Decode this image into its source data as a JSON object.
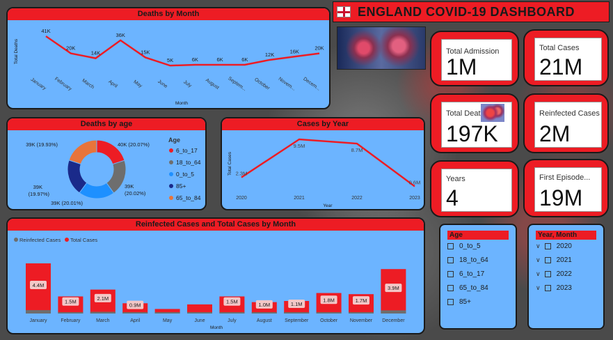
{
  "header": {
    "title": "ENGLAND COVID-19 DASHBOARD",
    "flag_icon": "uk-flag-icon"
  },
  "colors": {
    "accent": "#ed1c24",
    "panel": "#6cb4ff",
    "line": "#ed1c24",
    "gray_series": "#6e6e6e"
  },
  "deaths_by_month": {
    "title": "Deaths by Month",
    "ylabel": "Total Deaths",
    "xlabel": "Month",
    "months": [
      "January",
      "February",
      "March",
      "April",
      "May",
      "June",
      "July",
      "August",
      "Septem...",
      "October",
      "Novem...",
      "Decem..."
    ],
    "values": [
      41,
      20,
      14,
      36,
      15,
      5,
      6,
      6,
      6,
      12,
      16,
      20
    ],
    "labels": [
      "41K",
      "20K",
      "14K",
      "36K",
      "15K",
      "5K",
      "6K",
      "6K",
      "6K",
      "12K",
      "16K",
      "20K"
    ]
  },
  "deaths_by_age": {
    "title": "Deaths by age",
    "legend_title": "Age",
    "segments": [
      {
        "name": "6_to_17",
        "value": 20.07,
        "label": "40K (20.07%)",
        "color": "#ed1c24"
      },
      {
        "name": "18_to_64",
        "value": 20.02,
        "label": "39K (20.02%)",
        "color": "#6e6e6e"
      },
      {
        "name": "0_to_5",
        "value": 20.01,
        "label": "39K (20.01%)",
        "color": "#1e90ff"
      },
      {
        "name": "85+",
        "value": 19.97,
        "label": "39K (19.97%)",
        "color": "#1a2a8a"
      },
      {
        "name": "65_to_84",
        "value": 19.93,
        "label": "39K (19.93%)",
        "color": "#e8743a"
      }
    ]
  },
  "cases_by_year": {
    "title": "Cases by Year",
    "ylabel": "Total Cases",
    "xlabel": "Year",
    "years": [
      "2020",
      "2021",
      "2022",
      "2023"
    ],
    "values": [
      2.3,
      9.5,
      8.7,
      0.6
    ],
    "labels": [
      "2.3M",
      "9.5M",
      "8.7M",
      "0.6M"
    ]
  },
  "reinfected": {
    "title": "Reinfected Cases and Total Cases by Month",
    "legend": [
      "Reinfected Cases",
      "Total Cases"
    ],
    "xlabel": "Month",
    "months": [
      "January",
      "February",
      "March",
      "April",
      "May",
      "June",
      "July",
      "August",
      "September",
      "October",
      "November",
      "December"
    ],
    "total": [
      4.4,
      1.5,
      2.1,
      0.9,
      0.4,
      0.8,
      1.5,
      1.0,
      1.1,
      1.8,
      1.7,
      3.9
    ],
    "reinfected": [
      0.3,
      0.1,
      0.15,
      0.05,
      0.03,
      0.05,
      0.1,
      0.07,
      0.08,
      0.12,
      0.11,
      0.28
    ],
    "labels": [
      "4.4M",
      "1.5M",
      "2.1M",
      "0.9M",
      "",
      "",
      "1.5M",
      "1.0M",
      "1.1M",
      "1.8M",
      "1.7M",
      "3.9M"
    ]
  },
  "kpis": {
    "total_admission": {
      "label": "Total Admission",
      "value": "1M"
    },
    "total_cases": {
      "label": "Total Cases",
      "value": "21M"
    },
    "total_deaths": {
      "label": "Total Deaths",
      "value": "197K"
    },
    "reinfected_cases": {
      "label": "Reinfected Cases",
      "value": "2M"
    },
    "years": {
      "label": "Years",
      "value": "4"
    },
    "first_episode": {
      "label": "First Episode...",
      "value": "19M"
    }
  },
  "age_slicer": {
    "title": "Age",
    "items": [
      "0_to_5",
      "18_to_64",
      "6_to_17",
      "65_to_84",
      "85+"
    ]
  },
  "year_slicer": {
    "title": "Year, Month",
    "items": [
      "2020",
      "2021",
      "2022",
      "2023"
    ]
  }
}
